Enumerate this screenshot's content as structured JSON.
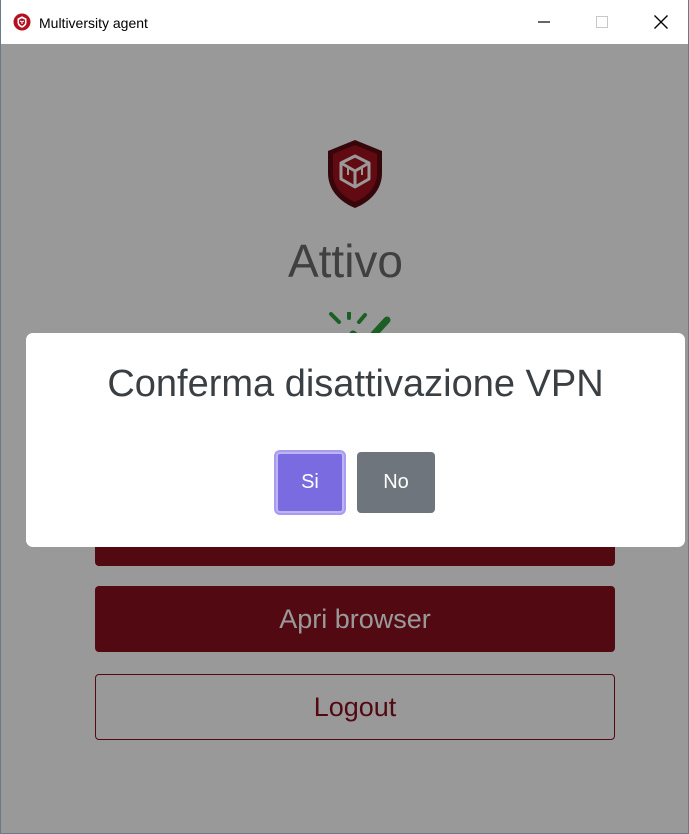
{
  "window": {
    "title": "Multiversity agent",
    "icons": {
      "app": "shield-logo-icon",
      "minimize": "minimize-icon",
      "maximize": "maximize-icon",
      "close": "close-icon"
    }
  },
  "main": {
    "status_title": "Attivo",
    "status_icon": "active-check-icon",
    "buttons": {
      "deactivate": "",
      "browser": "Apri browser",
      "logout": "Logout"
    }
  },
  "modal": {
    "title": "Conferma disattivazione VPN",
    "yes_label": "Si",
    "no_label": "No"
  },
  "colors": {
    "brand": "#8b0f1d",
    "primary": "#7a6be0",
    "secondary": "#6e757c",
    "status_text": "#6b6b6b"
  }
}
